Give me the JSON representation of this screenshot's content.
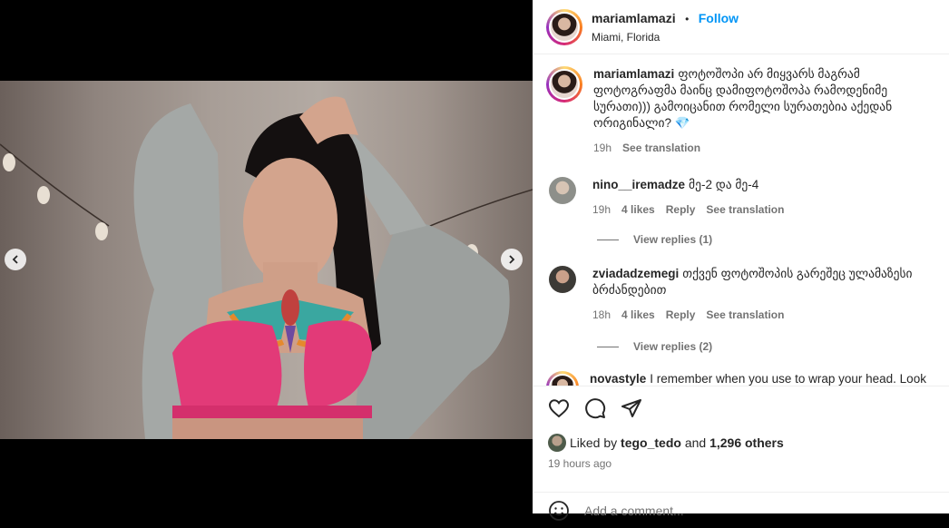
{
  "post": {
    "username": "mariamlamazi",
    "separator": "•",
    "follow_label": "Follow",
    "location": "Miami, Florida",
    "carousel": {
      "total": 5,
      "active_index": 3
    }
  },
  "caption": {
    "username": "mariamlamazi",
    "text": "ფოტოშოპი არ მიყვარს მაგრამ ფოტოგრაფმა მაინც დამიფოტოშოპა რამოდენიმე სურათი))) გამოიცანით რომელი სურათებია აქედან ორიგინალი? 💎",
    "time": "19h",
    "see_translation": "See translation"
  },
  "comments": [
    {
      "username": "nino__iremadze",
      "text": "მე-2 და მე-4",
      "time": "19h",
      "likes": "4 likes",
      "reply": "Reply",
      "see_translation": "See translation",
      "view_replies": "View replies (1)"
    },
    {
      "username": "zviadadzemegi",
      "text": "თქვენ ფოტოშოპის გარეშეც ულამაზესი ბრძანდებით",
      "time": "18h",
      "likes": "4 likes",
      "reply": "Reply",
      "see_translation": "See translation",
      "view_replies": "View replies (2)"
    },
    {
      "username": "novastyle",
      "text": "I remember when you use to wrap your head. Look"
    }
  ],
  "engagement": {
    "liked_by_prefix": "Liked by",
    "liked_by_user": "tego_tedo",
    "and": "and",
    "others": "1,296 others",
    "timestamp": "19 hours ago"
  },
  "add_comment": {
    "placeholder": "Add a comment..."
  },
  "colors": {
    "accent": "#0095f6",
    "text": "#262626",
    "muted": "#737373"
  }
}
